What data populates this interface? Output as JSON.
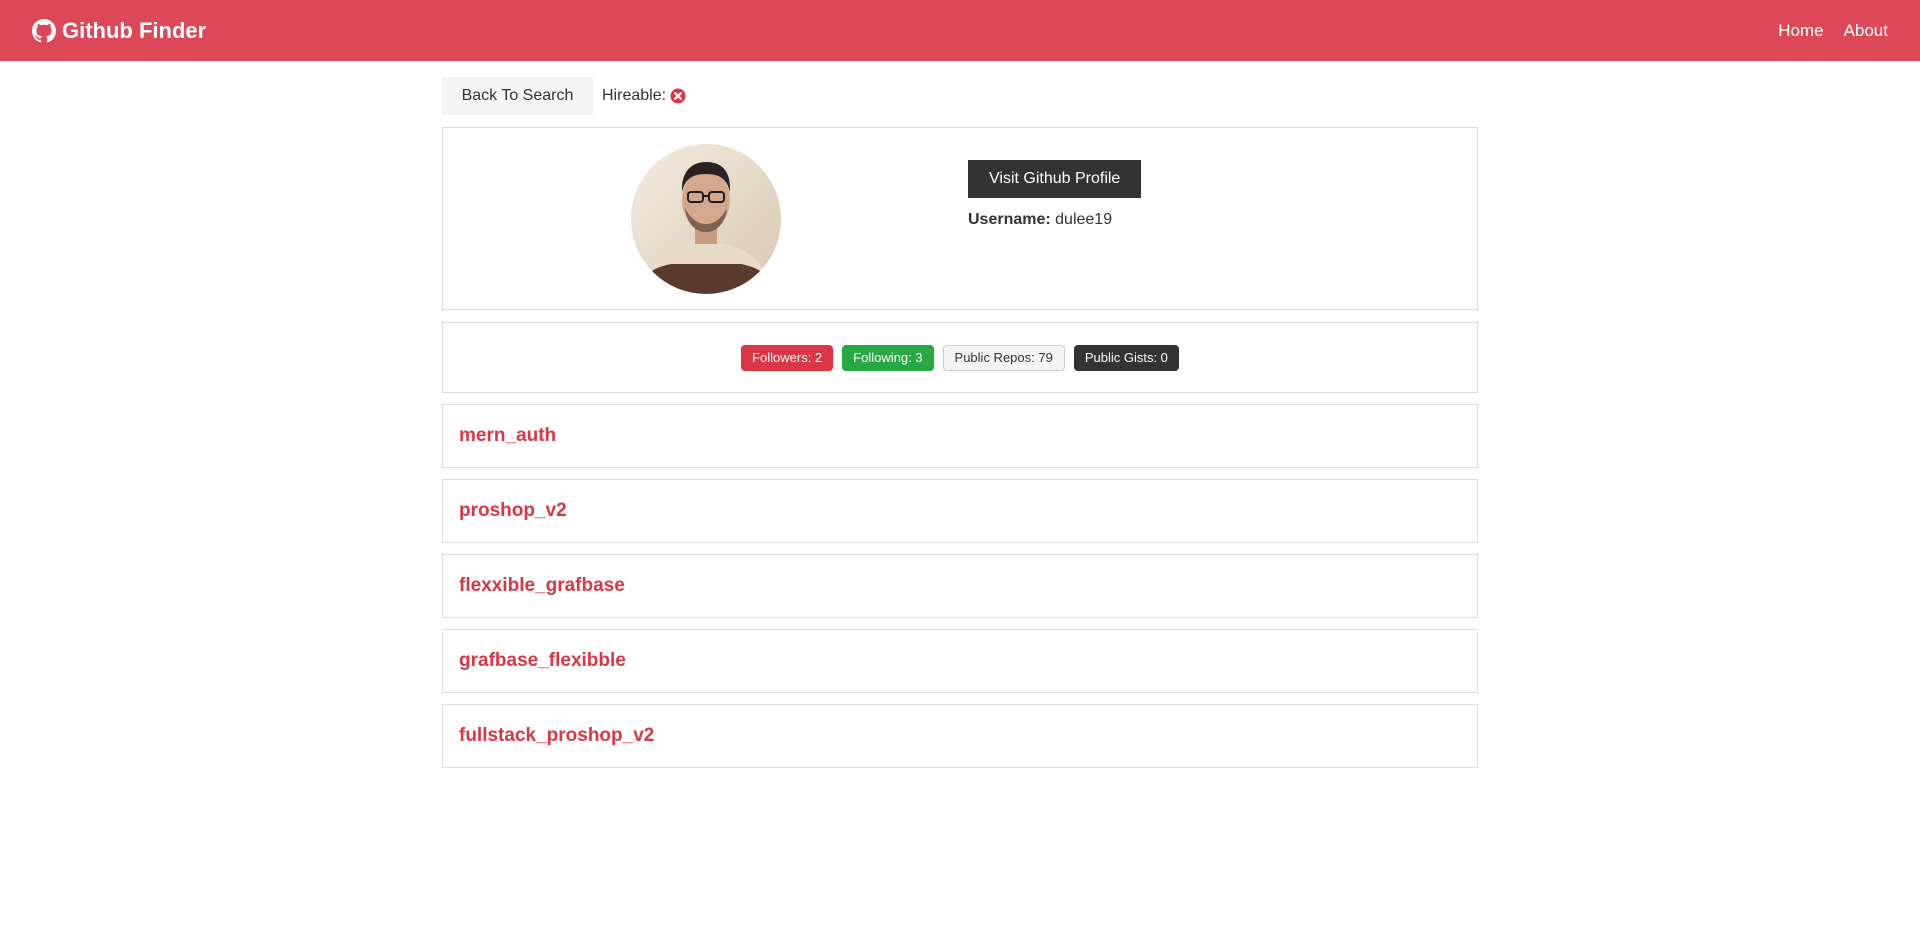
{
  "navbar": {
    "brand": "Github Finder",
    "brand_icon": "github-icon",
    "links": [
      "Home",
      "About"
    ],
    "bg_color": "#dc4858"
  },
  "toolbar": {
    "back_label": "Back To Search",
    "hireable_label": "Hireable:",
    "hireable_icon": "times-circle-icon"
  },
  "profile": {
    "visit_label": "Visit Github Profile",
    "username_label": "Username:",
    "username": "dulee19"
  },
  "stats": {
    "followers": "Followers: 2",
    "following": "Following: 3",
    "repos": "Public Repos: 79",
    "gists": "Public Gists: 0"
  },
  "repos": [
    "mern_auth",
    "proshop_v2",
    "flexxible_grafbase",
    "grafbase_flexibble",
    "fullstack_proshop_v2"
  ]
}
